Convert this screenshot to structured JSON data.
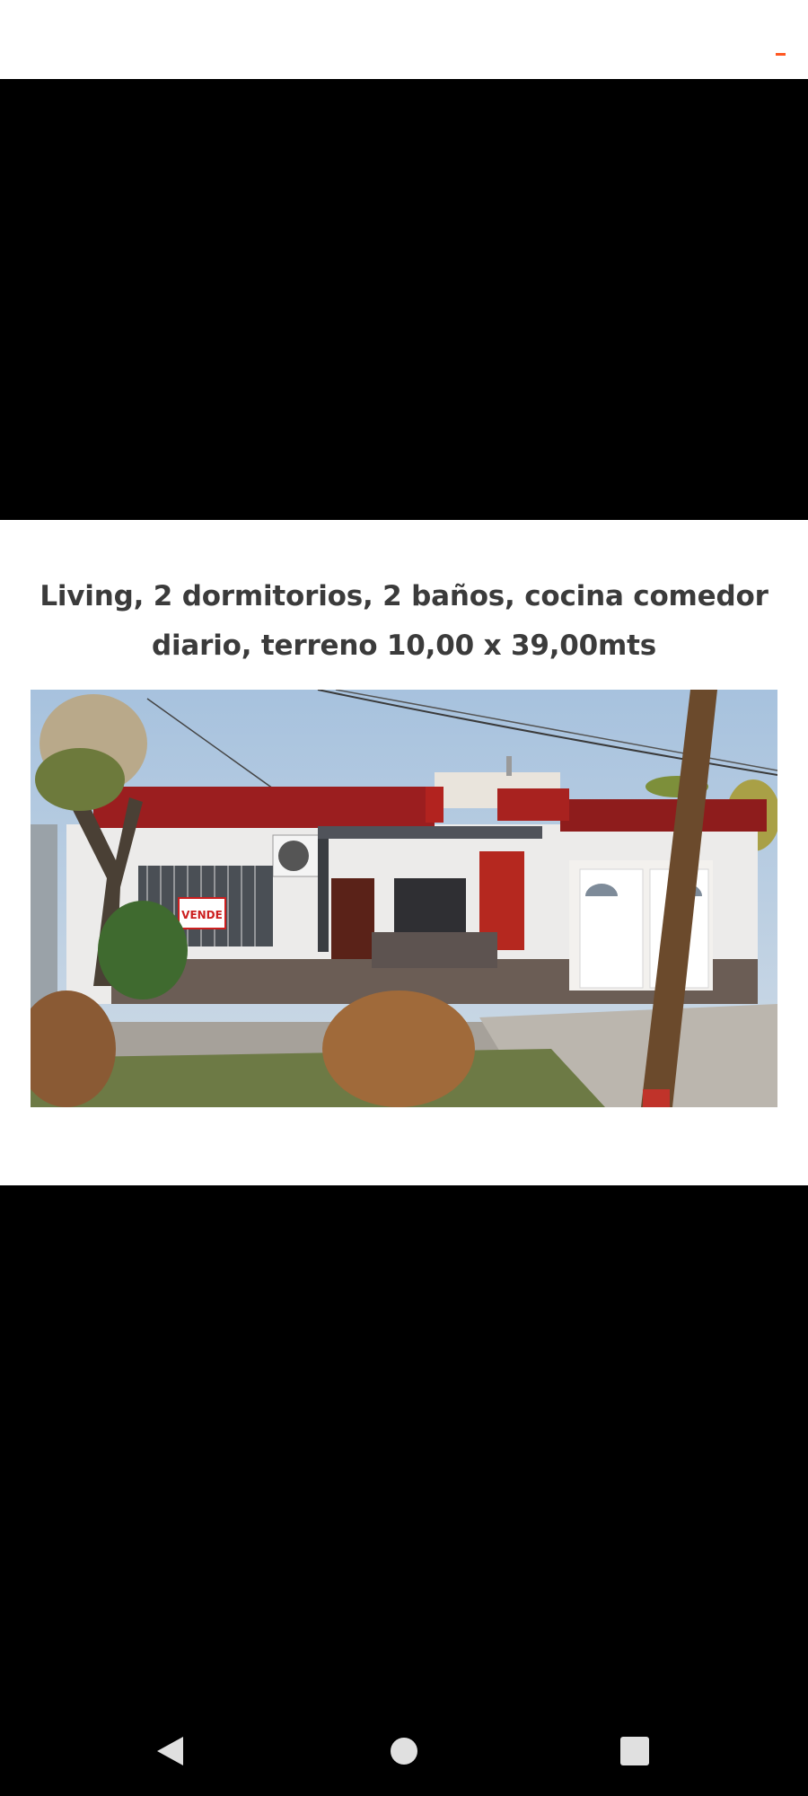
{
  "status": {
    "minimize_icon": "minimize-icon",
    "accent_color": "#ff5722"
  },
  "post": {
    "caption_line1": "Living, 2 dormitorios, 2 baños, cocina comedor",
    "caption_line2": "diario, terreno 10,00 x 39,00mts",
    "photo": {
      "sign_text": "VENDE"
    }
  },
  "navigation": {
    "back_icon": "back-triangle-icon",
    "home_icon": "home-circle-icon",
    "recents_icon": "recents-square-icon",
    "icon_color": "#e0e0e0"
  }
}
